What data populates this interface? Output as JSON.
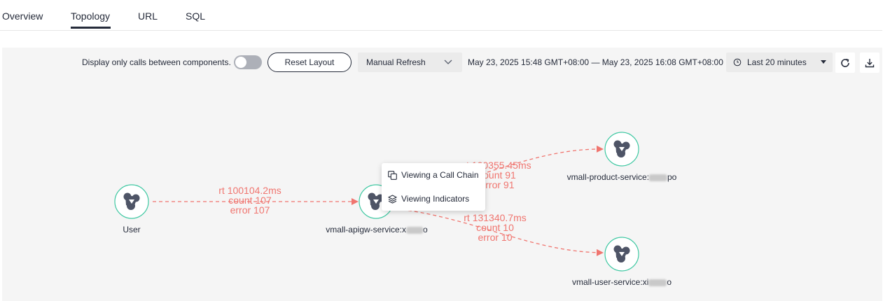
{
  "tabs": [
    "Overview",
    "Topology",
    "URL",
    "SQL"
  ],
  "active_tab": "Topology",
  "toolbar": {
    "switch_label": "Display only calls between components.",
    "reset_label": "Reset Layout",
    "refresh_select": "Manual Refresh",
    "time_range": "May 23, 2025 15:48 GMT+08:00 — May 23, 2025 16:08 GMT+08:00",
    "time_preset": "Last 20 minutes"
  },
  "nodes": {
    "user": {
      "label": "User"
    },
    "apigw": {
      "label_prefix": "vmall-apigw-service:x",
      "label_suffix": "o"
    },
    "product": {
      "label_prefix": "vmall-product-service:",
      "label_suffix": "po"
    },
    "usersvc": {
      "label_prefix": "vmall-user-service:xi",
      "label_suffix": "o"
    }
  },
  "edges": {
    "user_apigw": {
      "rt": "rt 100104.2ms",
      "count": "count 107",
      "error": "error 107"
    },
    "apigw_product": {
      "rt": "rt 100355.45ms",
      "count": "count 91",
      "error": "error 91"
    },
    "apigw_user": {
      "rt": "rt 131340.7ms",
      "count": "count 10",
      "error": "error 10"
    }
  },
  "context_menu": {
    "call_chain": "Viewing a Call Chain",
    "indicators": "Viewing Indicators"
  },
  "colors": {
    "edge": "#f0756f",
    "node_ring": "#3fc8a2",
    "node_icon": "#4e5466"
  }
}
